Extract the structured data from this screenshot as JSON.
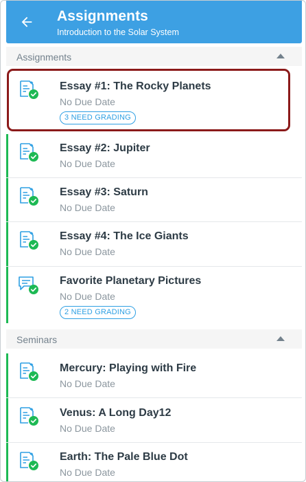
{
  "header": {
    "title": "Assignments",
    "subtitle": "Introduction to the Solar System",
    "back_icon": "arrow-left-icon"
  },
  "colors": {
    "appbar": "#3da0e3",
    "stripe": "#1db954",
    "badge": "#2d9fe3",
    "highlight": "#8b1a1a"
  },
  "groups": [
    {
      "name": "Assignments",
      "items": [
        {
          "title": "Essay #1: The Rocky Planets",
          "due": "No Due Date",
          "badge": "3 NEED GRADING",
          "icon": "assignment-icon",
          "highlighted": true
        },
        {
          "title": "Essay #2: Jupiter",
          "due": "No Due Date",
          "icon": "assignment-icon"
        },
        {
          "title": "Essay #3: Saturn",
          "due": "No Due Date",
          "icon": "assignment-icon"
        },
        {
          "title": "Essay #4: The Ice Giants",
          "due": "No Due Date",
          "icon": "assignment-icon"
        },
        {
          "title": "Favorite Planetary Pictures",
          "due": "No Due Date",
          "badge": "2 NEED GRADING",
          "icon": "discussion-icon"
        }
      ]
    },
    {
      "name": "Seminars",
      "items": [
        {
          "title": "Mercury: Playing with Fire",
          "due": "No Due Date",
          "icon": "assignment-icon"
        },
        {
          "title": "Venus: A Long Day12",
          "due": "No Due Date",
          "icon": "assignment-icon"
        },
        {
          "title": "Earth: The Pale Blue Dot",
          "due": "No Due Date",
          "icon": "assignment-icon"
        }
      ]
    }
  ]
}
